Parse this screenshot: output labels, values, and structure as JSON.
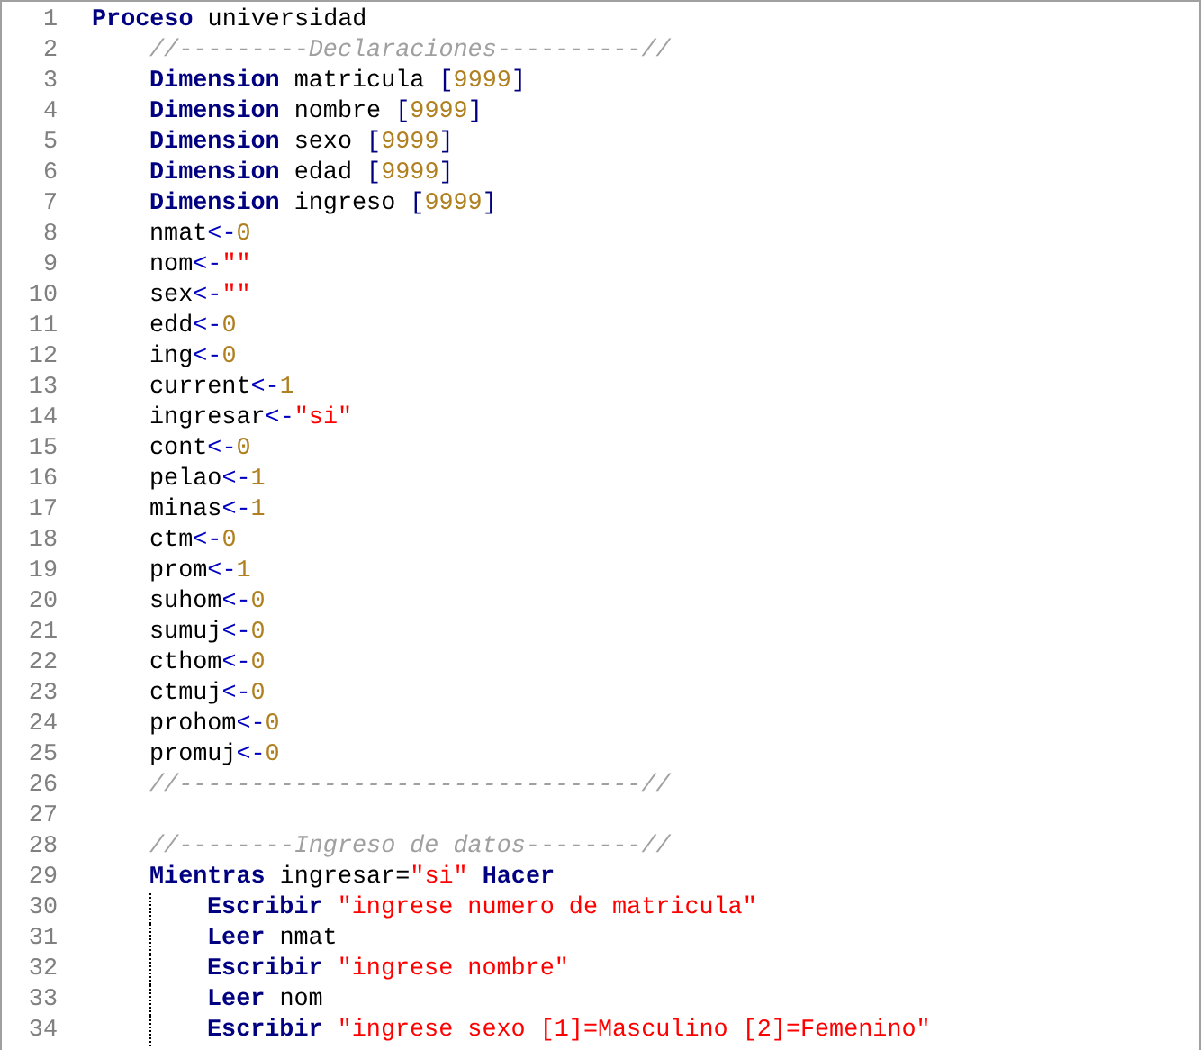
{
  "editor": {
    "lines": [
      {
        "number": "1",
        "tokens": [
          {
            "kind": "keyword",
            "text": "Proceso"
          },
          {
            "kind": "plain",
            "text": " universidad"
          }
        ],
        "children": [
          {
            "number": "2",
            "tokens": [
              {
                "kind": "comment",
                "text": "//---------Declaraciones----------//"
              }
            ]
          },
          {
            "number": "3",
            "tokens": [
              {
                "kind": "keyword",
                "text": "Dimension"
              },
              {
                "kind": "plain",
                "text": " matricula "
              },
              {
                "kind": "bracket",
                "text": "["
              },
              {
                "kind": "number",
                "text": "9999"
              },
              {
                "kind": "bracket",
                "text": "]"
              }
            ]
          },
          {
            "number": "4",
            "tokens": [
              {
                "kind": "keyword",
                "text": "Dimension"
              },
              {
                "kind": "plain",
                "text": " nombre "
              },
              {
                "kind": "bracket",
                "text": "["
              },
              {
                "kind": "number",
                "text": "9999"
              },
              {
                "kind": "bracket",
                "text": "]"
              }
            ]
          },
          {
            "number": "5",
            "tokens": [
              {
                "kind": "keyword",
                "text": "Dimension"
              },
              {
                "kind": "plain",
                "text": " sexo "
              },
              {
                "kind": "bracket",
                "text": "["
              },
              {
                "kind": "number",
                "text": "9999"
              },
              {
                "kind": "bracket",
                "text": "]"
              }
            ]
          },
          {
            "number": "6",
            "tokens": [
              {
                "kind": "keyword",
                "text": "Dimension"
              },
              {
                "kind": "plain",
                "text": " edad "
              },
              {
                "kind": "bracket",
                "text": "["
              },
              {
                "kind": "number",
                "text": "9999"
              },
              {
                "kind": "bracket",
                "text": "]"
              }
            ]
          },
          {
            "number": "7",
            "tokens": [
              {
                "kind": "keyword",
                "text": "Dimension"
              },
              {
                "kind": "plain",
                "text": " ingreso "
              },
              {
                "kind": "bracket",
                "text": "["
              },
              {
                "kind": "number",
                "text": "9999"
              },
              {
                "kind": "bracket",
                "text": "]"
              }
            ]
          },
          {
            "number": "8",
            "tokens": [
              {
                "kind": "plain",
                "text": "nmat"
              },
              {
                "kind": "operator",
                "text": "<-"
              },
              {
                "kind": "number",
                "text": "0"
              }
            ]
          },
          {
            "number": "9",
            "tokens": [
              {
                "kind": "plain",
                "text": "nom"
              },
              {
                "kind": "operator",
                "text": "<-"
              },
              {
                "kind": "string",
                "text": "\"\""
              }
            ]
          },
          {
            "number": "10",
            "tokens": [
              {
                "kind": "plain",
                "text": "sex"
              },
              {
                "kind": "operator",
                "text": "<-"
              },
              {
                "kind": "string",
                "text": "\"\""
              }
            ]
          },
          {
            "number": "11",
            "tokens": [
              {
                "kind": "plain",
                "text": "edd"
              },
              {
                "kind": "operator",
                "text": "<-"
              },
              {
                "kind": "number",
                "text": "0"
              }
            ]
          },
          {
            "number": "12",
            "tokens": [
              {
                "kind": "plain",
                "text": "ing"
              },
              {
                "kind": "operator",
                "text": "<-"
              },
              {
                "kind": "number",
                "text": "0"
              }
            ]
          },
          {
            "number": "13",
            "tokens": [
              {
                "kind": "plain",
                "text": "current"
              },
              {
                "kind": "operator",
                "text": "<-"
              },
              {
                "kind": "number",
                "text": "1"
              }
            ]
          },
          {
            "number": "14",
            "tokens": [
              {
                "kind": "plain",
                "text": "ingresar"
              },
              {
                "kind": "operator",
                "text": "<-"
              },
              {
                "kind": "string",
                "text": "\"si\""
              }
            ]
          },
          {
            "number": "15",
            "tokens": [
              {
                "kind": "plain",
                "text": "cont"
              },
              {
                "kind": "operator",
                "text": "<-"
              },
              {
                "kind": "number",
                "text": "0"
              }
            ]
          },
          {
            "number": "16",
            "tokens": [
              {
                "kind": "plain",
                "text": "pelao"
              },
              {
                "kind": "operator",
                "text": "<-"
              },
              {
                "kind": "number",
                "text": "1"
              }
            ]
          },
          {
            "number": "17",
            "tokens": [
              {
                "kind": "plain",
                "text": "minas"
              },
              {
                "kind": "operator",
                "text": "<-"
              },
              {
                "kind": "number",
                "text": "1"
              }
            ]
          },
          {
            "number": "18",
            "tokens": [
              {
                "kind": "plain",
                "text": "ctm"
              },
              {
                "kind": "operator",
                "text": "<-"
              },
              {
                "kind": "number",
                "text": "0"
              }
            ]
          },
          {
            "number": "19",
            "tokens": [
              {
                "kind": "plain",
                "text": "prom"
              },
              {
                "kind": "operator",
                "text": "<-"
              },
              {
                "kind": "number",
                "text": "1"
              }
            ]
          },
          {
            "number": "20",
            "tokens": [
              {
                "kind": "plain",
                "text": "suhom"
              },
              {
                "kind": "operator",
                "text": "<-"
              },
              {
                "kind": "number",
                "text": "0"
              }
            ]
          },
          {
            "number": "21",
            "tokens": [
              {
                "kind": "plain",
                "text": "sumuj"
              },
              {
                "kind": "operator",
                "text": "<-"
              },
              {
                "kind": "number",
                "text": "0"
              }
            ]
          },
          {
            "number": "22",
            "tokens": [
              {
                "kind": "plain",
                "text": "cthom"
              },
              {
                "kind": "operator",
                "text": "<-"
              },
              {
                "kind": "number",
                "text": "0"
              }
            ]
          },
          {
            "number": "23",
            "tokens": [
              {
                "kind": "plain",
                "text": "ctmuj"
              },
              {
                "kind": "operator",
                "text": "<-"
              },
              {
                "kind": "number",
                "text": "0"
              }
            ]
          },
          {
            "number": "24",
            "tokens": [
              {
                "kind": "plain",
                "text": "prohom"
              },
              {
                "kind": "operator",
                "text": "<-"
              },
              {
                "kind": "number",
                "text": "0"
              }
            ]
          },
          {
            "number": "25",
            "tokens": [
              {
                "kind": "plain",
                "text": "promuj"
              },
              {
                "kind": "operator",
                "text": "<-"
              },
              {
                "kind": "number",
                "text": "0"
              }
            ]
          },
          {
            "number": "26",
            "tokens": [
              {
                "kind": "comment",
                "text": "//--------------------------------//"
              }
            ]
          },
          {
            "number": "27"
          },
          {
            "number": "28",
            "tokens": [
              {
                "kind": "comment",
                "text": "//--------Ingreso de datos--------//"
              }
            ]
          },
          {
            "number": "29",
            "tokens": [
              {
                "kind": "keyword",
                "text": "Mientras"
              },
              {
                "kind": "plain",
                "text": " ingresar="
              },
              {
                "kind": "string",
                "text": "\"si\""
              },
              {
                "kind": "keyword",
                "text": " Hacer"
              }
            ],
            "children": [
              {
                "number": "30",
                "tokens": [
                  {
                    "kind": "keyword",
                    "text": "Escribir"
                  },
                  {
                    "kind": "string",
                    "text": " \"ingrese numero de matricula\""
                  }
                ]
              },
              {
                "number": "31",
                "tokens": [
                  {
                    "kind": "keyword",
                    "text": "Leer"
                  },
                  {
                    "kind": "plain",
                    "text": " nmat"
                  }
                ]
              },
              {
                "number": "32",
                "tokens": [
                  {
                    "kind": "keyword",
                    "text": "Escribir"
                  },
                  {
                    "kind": "string",
                    "text": " \"ingrese nombre\""
                  }
                ]
              },
              {
                "number": "33",
                "tokens": [
                  {
                    "kind": "keyword",
                    "text": "Leer"
                  },
                  {
                    "kind": "plain",
                    "text": " nom"
                  }
                ]
              },
              {
                "number": "34",
                "tokens": [
                  {
                    "kind": "keyword",
                    "text": "Escribir"
                  },
                  {
                    "kind": "string",
                    "text": " \"ingrese sexo [1]=Masculino [2]=Femenino\""
                  }
                ]
              }
            ]
          }
        ]
      }
    ]
  }
}
